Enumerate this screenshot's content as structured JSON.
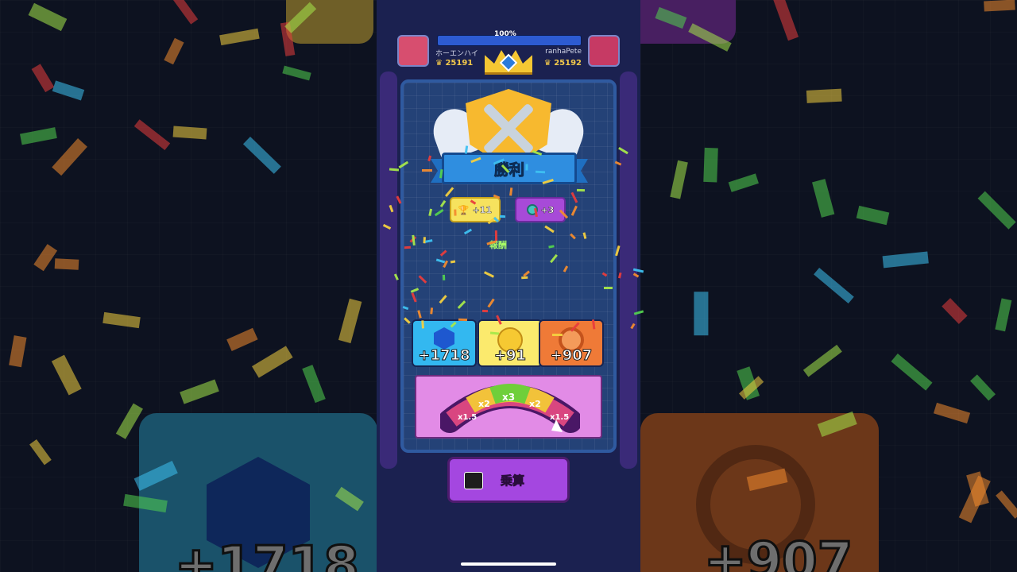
{
  "top": {
    "progress_label": "100%",
    "progress": 1.0,
    "left_player": {
      "name": "ホーエンハイ",
      "trophies": "25191"
    },
    "right_player": {
      "name": "ranhaPete",
      "trophies": "25192"
    }
  },
  "result": {
    "title": "勝利"
  },
  "chips": {
    "trophy": "+11",
    "gem": "+3"
  },
  "rewards": {
    "label": "報酬",
    "items": [
      {
        "value": "+1718",
        "icon": "cube-icon"
      },
      {
        "value": "+91",
        "icon": "coin-icon"
      },
      {
        "value": "+907",
        "icon": "medal-icon"
      }
    ]
  },
  "multiplier": {
    "segments": [
      "x1.5",
      "x2",
      "x3",
      "x2",
      "x1.5"
    ],
    "button_label": "乗算"
  },
  "background": {
    "left_value": "+1718",
    "right_value": "+907"
  },
  "colors": {
    "blue_tile": "#33b8f0",
    "yellow_tile": "#fbea6d",
    "orange_tile": "#ef7a37",
    "multiply_button": "#a447e0",
    "banner": "#2f8ee0"
  }
}
